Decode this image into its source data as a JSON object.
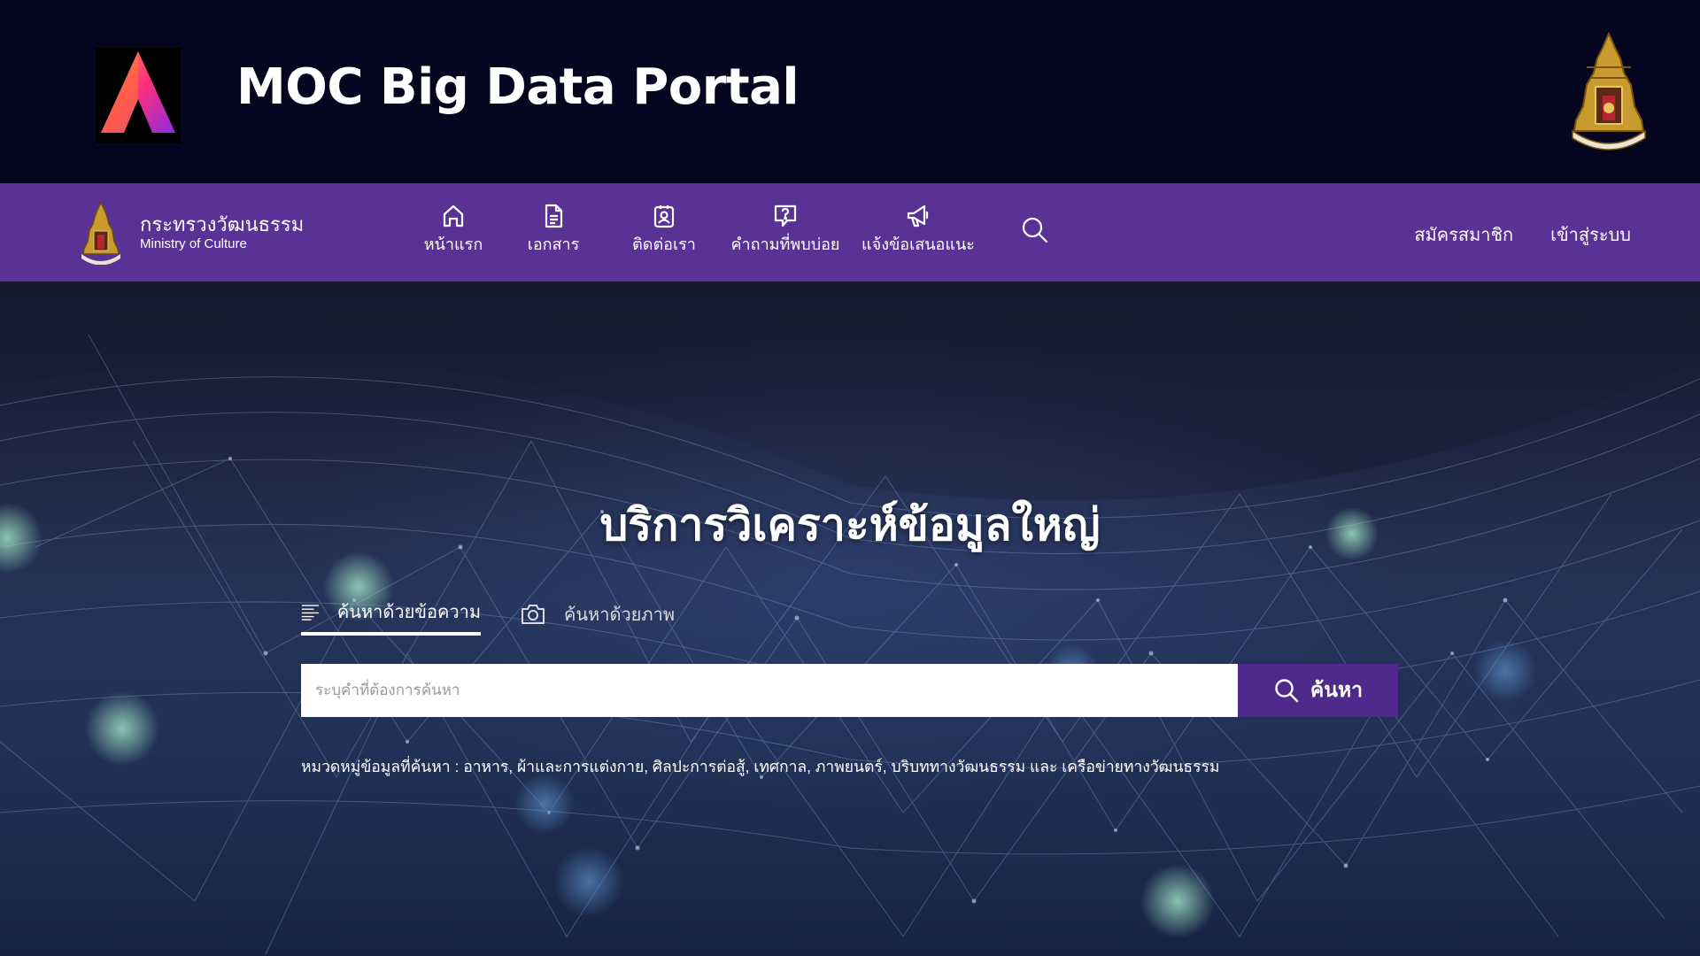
{
  "app": {
    "title": "MOC Big Data Portal"
  },
  "ministry": {
    "name_th": "กระทรวงวัฒนธรรม",
    "name_en": "Ministry of Culture"
  },
  "nav": {
    "items": [
      {
        "label": "หน้าแรก",
        "icon": "home-icon"
      },
      {
        "label": "เอกสาร",
        "icon": "document-icon"
      },
      {
        "label": "ติดต่อเรา",
        "icon": "contact-icon"
      },
      {
        "label": "คำถามที่พบบ่อย",
        "icon": "faq-icon"
      },
      {
        "label": "แจ้งข้อเสนอแนะ",
        "icon": "megaphone-icon"
      }
    ],
    "register_label": "สมัครสมาชิก",
    "login_label": "เข้าสู่ระบบ"
  },
  "hero": {
    "title": "บริการวิเคราะห์ข้อมูลใหญ่",
    "tabs": [
      {
        "label": "ค้นหาด้วยข้อความ",
        "icon": "text-lines-icon",
        "active": true
      },
      {
        "label": "ค้นหาด้วยภาพ",
        "icon": "camera-icon",
        "active": false
      }
    ],
    "search": {
      "placeholder": "ระบุคำที่ต้องการค้นหา",
      "value": "",
      "button_label": "ค้นหา"
    },
    "categories_text": "หมวดหมู่ข้อมูลที่ค้นหา : อาหาร, ผ้าและการแต่งกาย, ศิลปะการต่อสู้, เทศกาล, ภาพยนตร์, บริบททางวัฒนธรรม และ เครือข่ายทางวัฒนธรรม"
  },
  "colors": {
    "banner_bg": "#05051f",
    "nav_bg": "#5a3296",
    "search_button_bg": "#4f2a8c"
  }
}
